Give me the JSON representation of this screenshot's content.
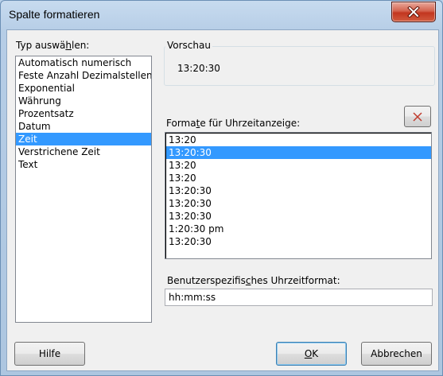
{
  "window": {
    "title": "Spalte formatieren"
  },
  "type_section": {
    "label_pre": "Typ auswä",
    "label_mnemonic": "h",
    "label_post": "len:",
    "items": [
      {
        "label": "Automatisch numerisch"
      },
      {
        "label": "Feste Anzahl Dezimalstellen"
      },
      {
        "label": "Exponential"
      },
      {
        "label": "Währung"
      },
      {
        "label": "Prozentsatz"
      },
      {
        "label": "Datum"
      },
      {
        "label": "Zeit",
        "selected": true
      },
      {
        "label": "Verstrichene Zeit"
      },
      {
        "label": "Text"
      }
    ]
  },
  "preview": {
    "label": "Vorschau",
    "value": "13:20:30"
  },
  "formats_section": {
    "label_pre": "Forma",
    "label_mnemonic": "t",
    "label_post": "e für Uhrzeitanzeige:",
    "items": [
      {
        "label": "13:20"
      },
      {
        "label": "13:20:30",
        "selected": true
      },
      {
        "label": "13:20"
      },
      {
        "label": "13:20"
      },
      {
        "label": "13:20:30"
      },
      {
        "label": "13:20:30"
      },
      {
        "label": "13:20:30"
      },
      {
        "label": "1:20:30 pm"
      },
      {
        "label": "13:20:30"
      }
    ]
  },
  "custom_format": {
    "label_pre": "Benutzerspezifis",
    "label_mnemonic": "c",
    "label_post": "hes Uhrzeitformat:",
    "value": "hh:mm:ss"
  },
  "buttons": {
    "help": "Hilfe",
    "ok_mnemonic": "O",
    "ok_rest": "K",
    "cancel": "Abbrechen"
  },
  "colors": {
    "selection": "#3399ff",
    "delete_icon": "#c0392b"
  }
}
